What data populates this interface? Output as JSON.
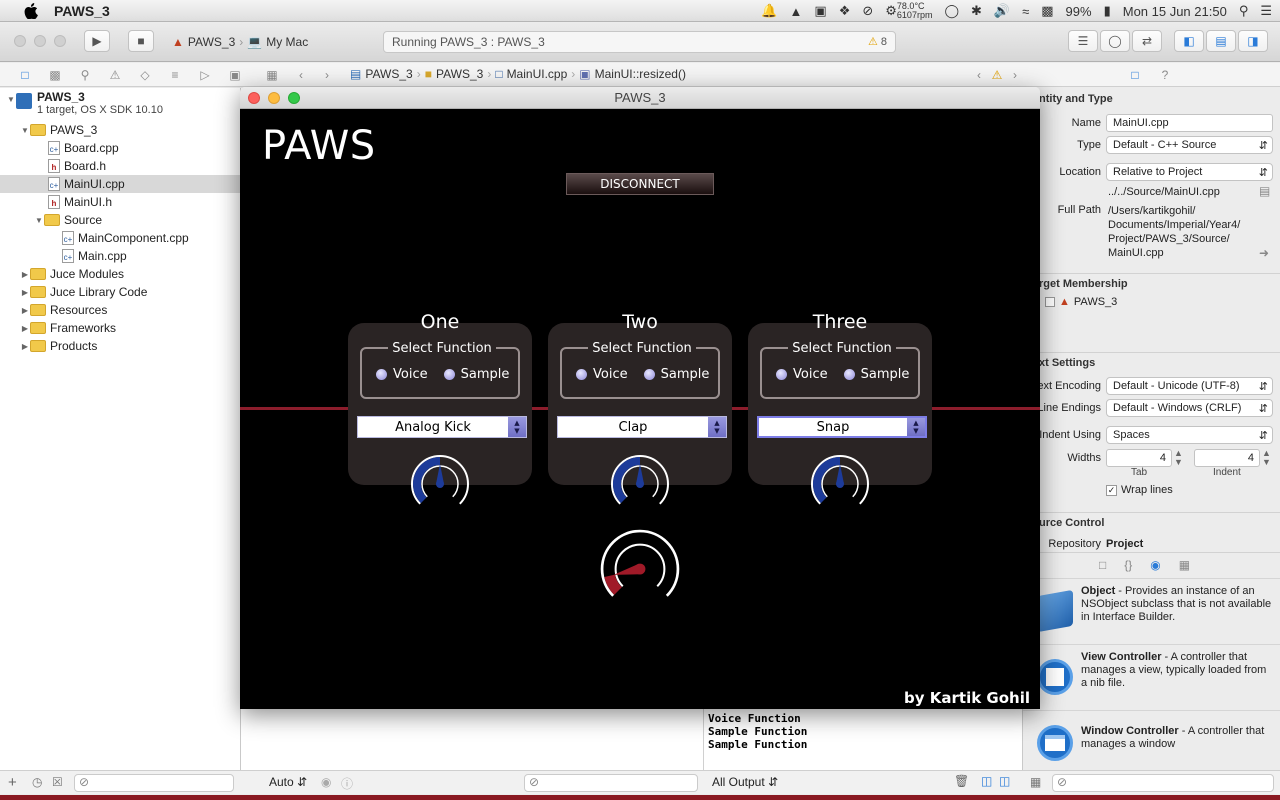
{
  "menubar": {
    "app_name": "PAWS_3",
    "cpu_temp": "78.0°C",
    "cpu_rpm": "6107rpm",
    "battery": "99%",
    "datetime": "Mon 15 Jun  21:50"
  },
  "toolbar": {
    "scheme_target": "PAWS_3",
    "scheme_device": "My Mac",
    "status_text": "Running PAWS_3 : PAWS_3",
    "warning_count": "8"
  },
  "jumpbar": {
    "crumbs": [
      "PAWS_3",
      "PAWS_3",
      "MainUI.cpp",
      "MainUI::resized()"
    ]
  },
  "navigator": {
    "project_name": "PAWS_3",
    "project_sub": "1 target, OS X SDK 10.10",
    "items": [
      {
        "label": "PAWS_3"
      },
      {
        "label": "Board.cpp"
      },
      {
        "label": "Board.h"
      },
      {
        "label": "MainUI.cpp"
      },
      {
        "label": "MainUI.h"
      },
      {
        "label": "Source"
      },
      {
        "label": "MainComponent.cpp"
      },
      {
        "label": "Main.cpp"
      },
      {
        "label": "Juce Modules"
      },
      {
        "label": "Juce Library Code"
      },
      {
        "label": "Resources"
      },
      {
        "label": "Frameworks"
      },
      {
        "label": "Products"
      }
    ]
  },
  "editor_bottom": {
    "auto_label": "Auto",
    "output_label": "All Output"
  },
  "console": {
    "lines": [
      "Voice Function",
      "Sample Function",
      "Sample Function"
    ]
  },
  "inspector": {
    "identity_header": "ntity and Type",
    "name_label": "Name",
    "name_value": "MainUI.cpp",
    "type_label": "Type",
    "type_value": "Default - C++ Source",
    "location_label": "Location",
    "location_value": "Relative to Project",
    "relative_path": "../../Source/MainUI.cpp",
    "fullpath_label": "Full Path",
    "fullpath_value_1": "/Users/kartikgohil/",
    "fullpath_value_2": "Documents/Imperial/Year4/",
    "fullpath_value_3": "Project/PAWS_3/Source/",
    "fullpath_value_4": "MainUI.cpp",
    "target_header": "rget Membership",
    "target_name": "PAWS_3",
    "text_header": "xt Settings",
    "encoding_label": "ext Encoding",
    "encoding_value": "Default - Unicode (UTF-8)",
    "endings_label": "Line Endings",
    "endings_value": "Default - Windows (CRLF)",
    "indent_label": "Indent Using",
    "indent_value": "Spaces",
    "widths_label": "Widths",
    "tab_value": "4",
    "indent_width_value": "4",
    "tab_caption": "Tab",
    "indent_caption": "Indent",
    "wrap_label": "Wrap lines",
    "source_header": "urce Control",
    "repo_label": "Repository",
    "repo_value": "Project"
  },
  "library": [
    {
      "title": "Object",
      "desc": " - Provides an instance of an NSObject subclass that is not available in Interface Builder."
    },
    {
      "title": "View Controller",
      "desc": " - A controller that manages a view, typically loaded from a nib file."
    },
    {
      "title": "Window Controller",
      "desc": " - A controller that manages a window"
    }
  ],
  "paws": {
    "window_title": "PAWS_3",
    "app_title": "PAWS",
    "disconnect_label": "DISCONNECT",
    "byline": "by Kartik Gohil",
    "group_title": "Select Function",
    "voice_label": "Voice",
    "sample_label": "Sample",
    "channels": [
      {
        "name": "One",
        "sound": "Analog Kick",
        "knob_level": 0.5
      },
      {
        "name": "Two",
        "sound": "Clap",
        "knob_level": 0.5
      },
      {
        "name": "Three",
        "sound": "Snap",
        "knob_level": 0.5
      }
    ],
    "master_knob_level": 0.12,
    "colors": {
      "accent_red": "#8c1d2c",
      "knob_blue": "#1d3b9a",
      "panel": "#2a2424"
    }
  }
}
